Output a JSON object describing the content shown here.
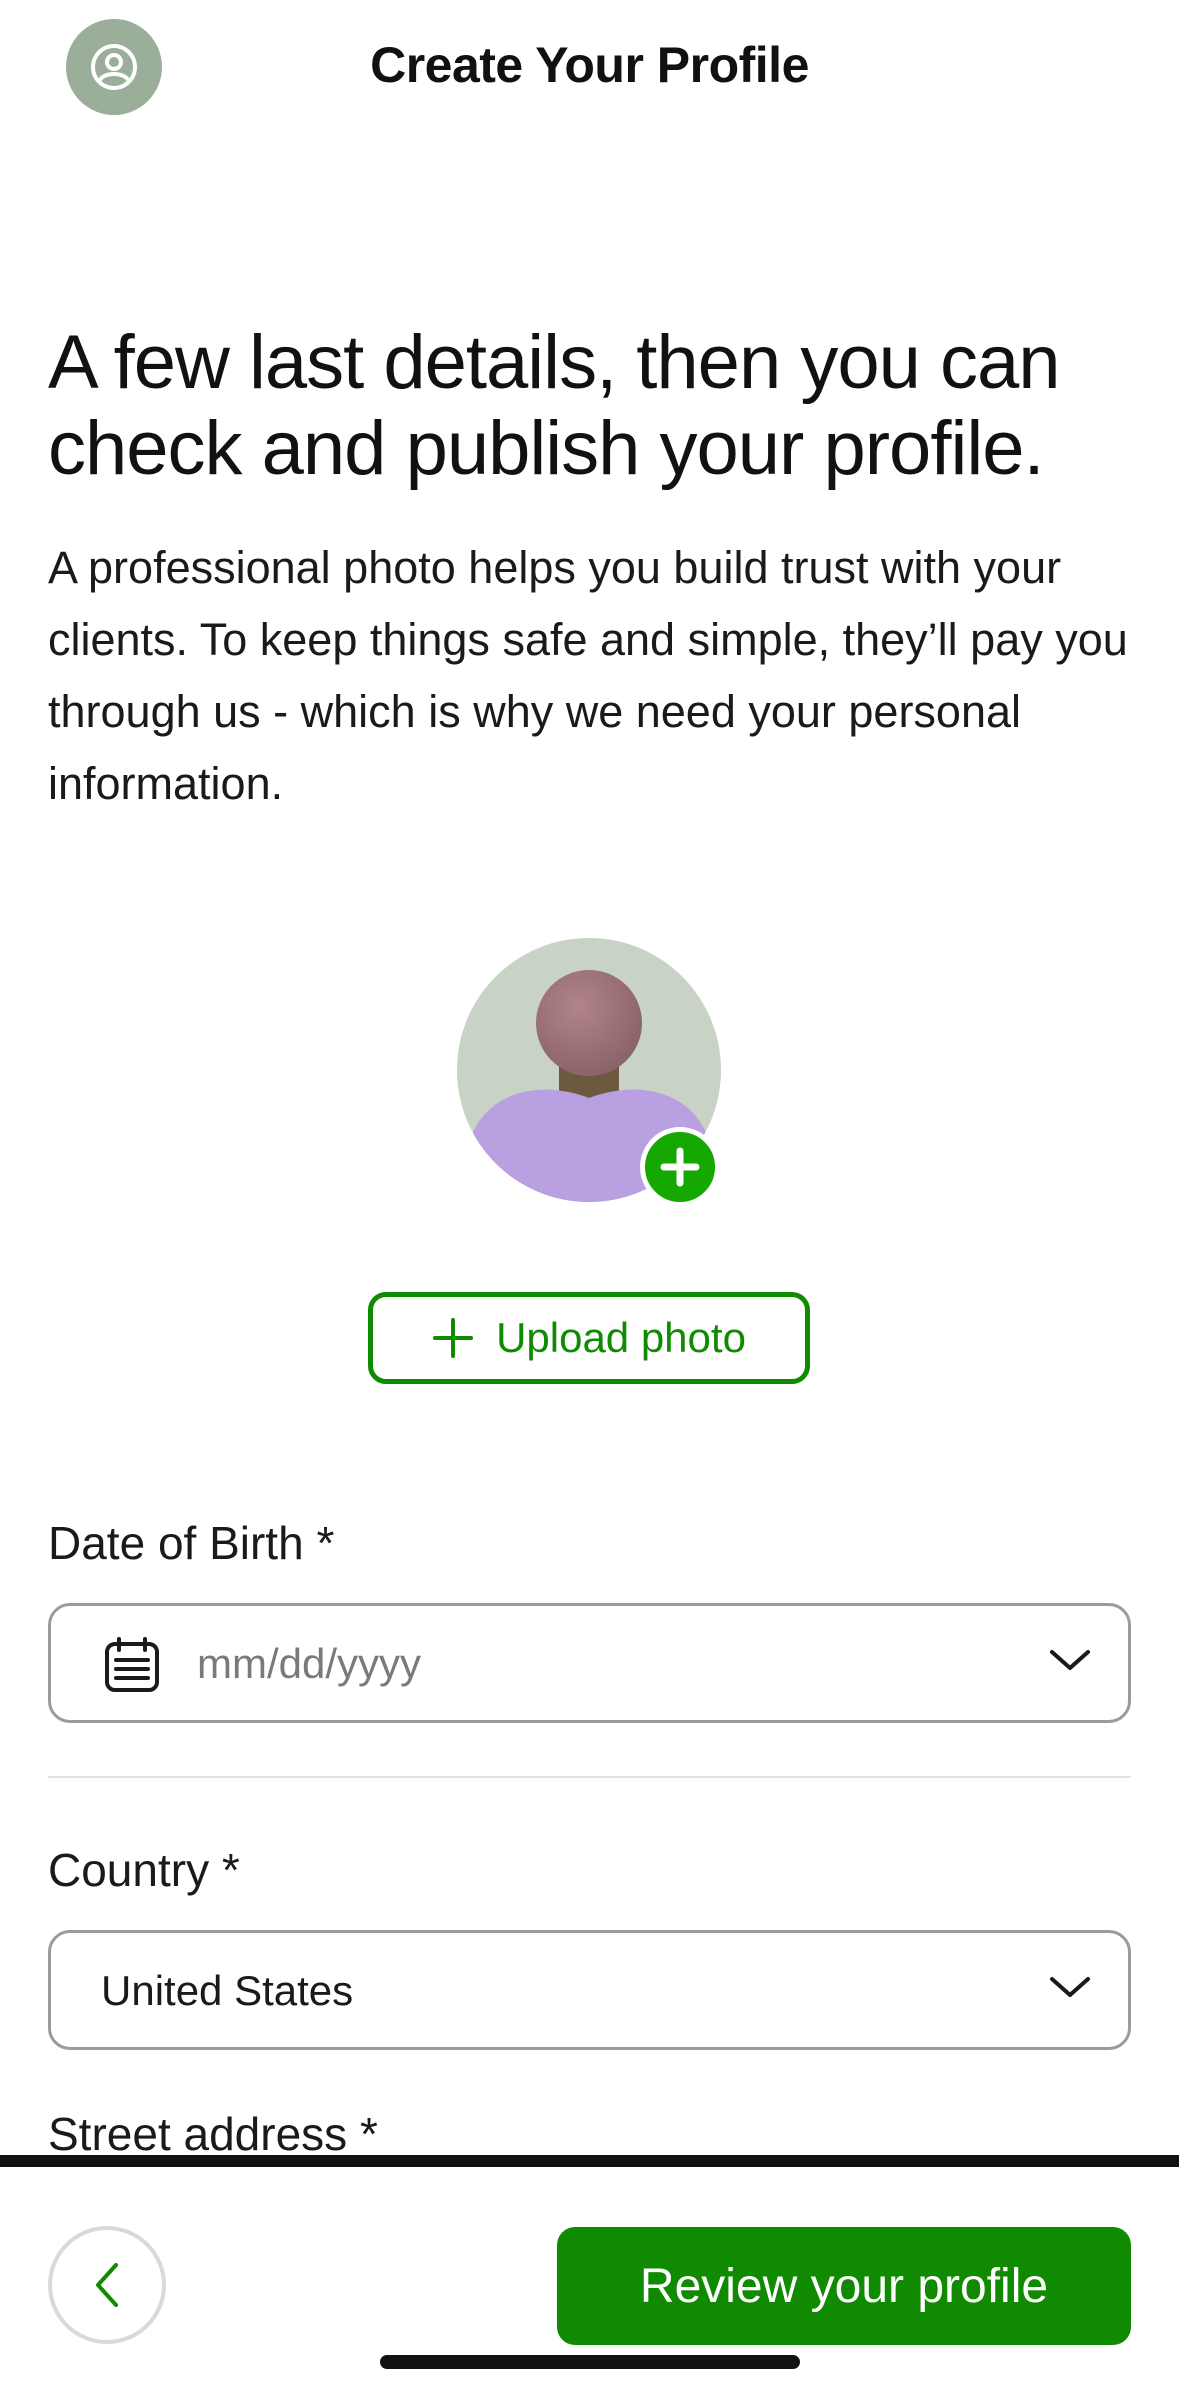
{
  "header": {
    "title": "Create Your Profile",
    "avatar_icon": "user-circle-icon"
  },
  "main": {
    "headline": "A few last details, then you can check and publish your profile.",
    "intro": "A professional photo helps you build trust with your clients. To keep things safe and simple, they’ll pay you through us - which is why we need your personal information.",
    "photo": {
      "badge_icon": "plus-icon",
      "upload_label": "Upload photo",
      "upload_icon": "plus-icon"
    },
    "fields": {
      "dob": {
        "label": "Date of Birth *",
        "placeholder": "mm/dd/yyyy",
        "icon": "calendar-icon"
      },
      "country": {
        "label": "Country *",
        "value": "United States"
      },
      "street": {
        "label": "Street address *"
      }
    }
  },
  "footer": {
    "back_icon": "chevron-left-icon",
    "review_label": "Review your profile"
  },
  "colors": {
    "brand_green": "#108a00",
    "badge_green": "#14a800",
    "avatar_bg": "#9aae9a"
  }
}
